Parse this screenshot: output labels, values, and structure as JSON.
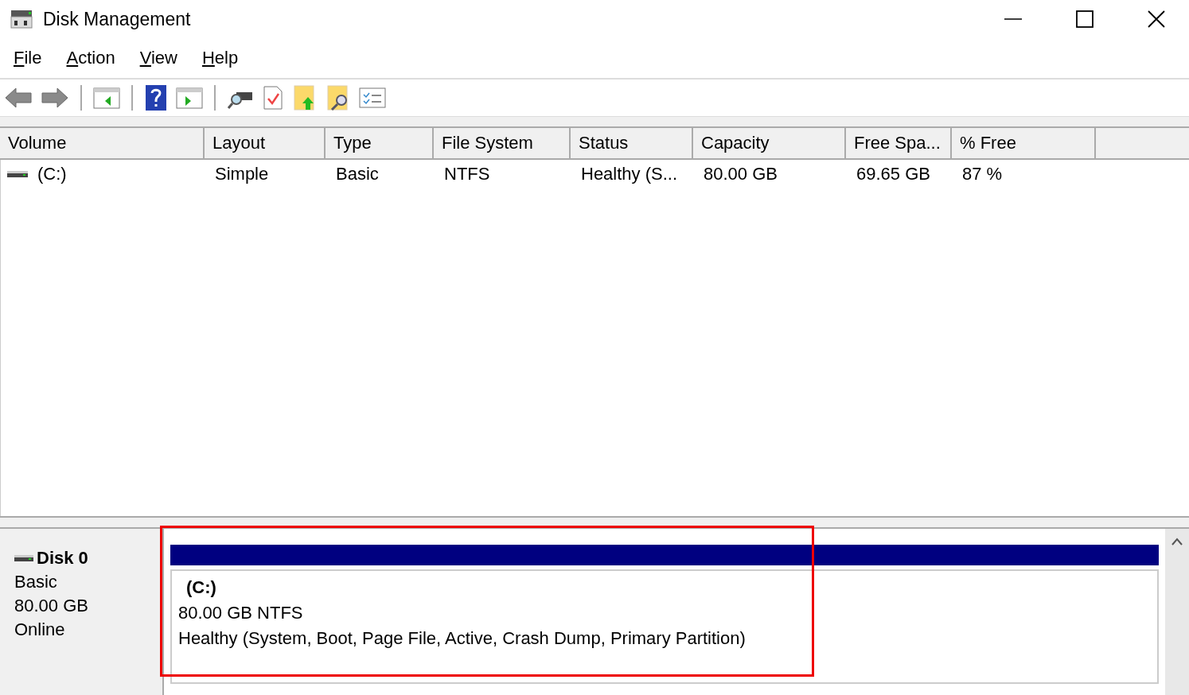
{
  "window": {
    "title": "Disk Management"
  },
  "menu": [
    "File",
    "Action",
    "View",
    "Help"
  ],
  "table": {
    "columns": [
      "Volume",
      "Layout",
      "Type",
      "File System",
      "Status",
      "Capacity",
      "Free Spa...",
      "% Free"
    ],
    "rows": [
      {
        "cells": [
          "(C:)",
          "Simple",
          "Basic",
          "NTFS",
          "Healthy (S...",
          "80.00 GB",
          "69.65 GB",
          "87 %"
        ],
        "selected": false
      }
    ]
  },
  "disk": {
    "name": "Disk 0",
    "type": "Basic",
    "size": "80.00 GB",
    "state": "Online",
    "partition": {
      "name": "(C:)",
      "size_fs": "80.00 GB NTFS",
      "status": "Healthy (System, Boot, Page File, Active, Crash Dump, Primary Partition)"
    }
  }
}
